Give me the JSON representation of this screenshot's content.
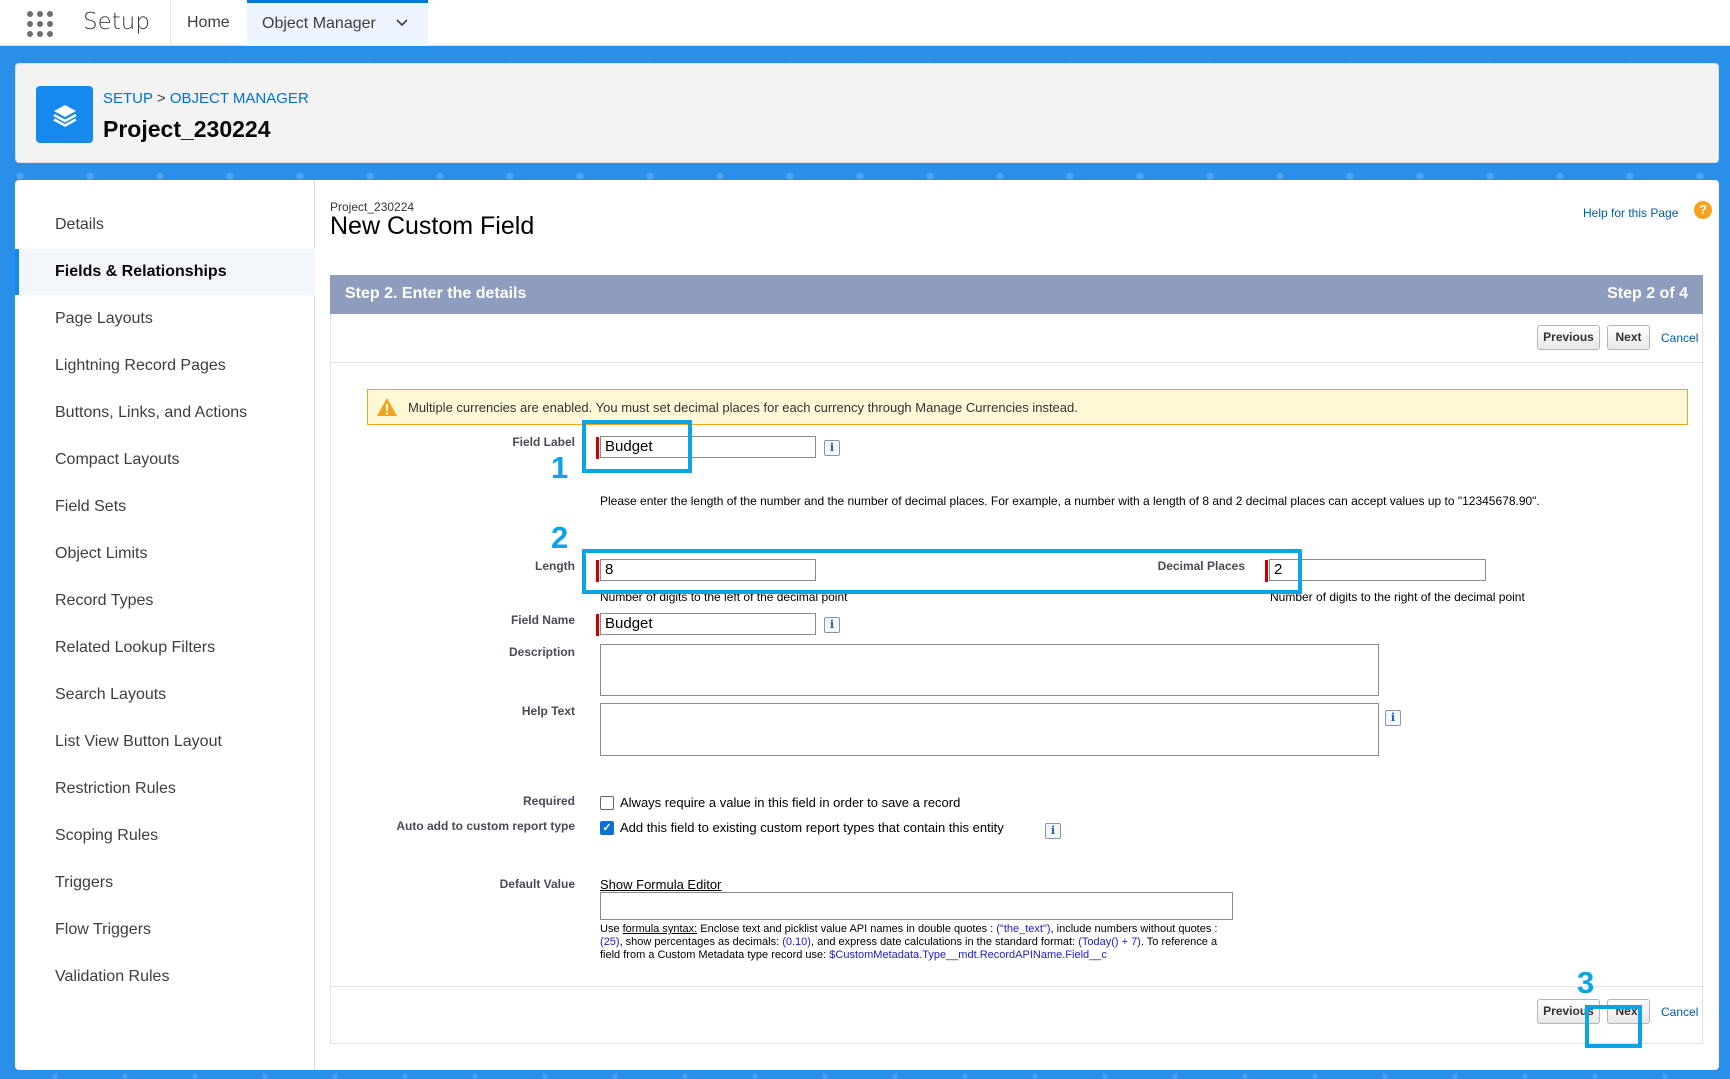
{
  "topnav": {
    "app_name": "Setup",
    "tabs": [
      {
        "label": "Home"
      },
      {
        "label": "Object Manager"
      }
    ]
  },
  "header": {
    "breadcrumb": [
      "SETUP",
      "OBJECT MANAGER"
    ],
    "breadcrumb_sep": ">",
    "title": "Project_230224"
  },
  "sidebar": {
    "items": [
      {
        "label": "Details"
      },
      {
        "label": "Fields & Relationships",
        "active": true
      },
      {
        "label": "Page Layouts"
      },
      {
        "label": "Lightning Record Pages"
      },
      {
        "label": "Buttons, Links, and Actions"
      },
      {
        "label": "Compact Layouts"
      },
      {
        "label": "Field Sets"
      },
      {
        "label": "Object Limits"
      },
      {
        "label": "Record Types"
      },
      {
        "label": "Related Lookup Filters"
      },
      {
        "label": "Search Layouts"
      },
      {
        "label": "List View Button Layout"
      },
      {
        "label": "Restriction Rules"
      },
      {
        "label": "Scoping Rules"
      },
      {
        "label": "Triggers"
      },
      {
        "label": "Flow Triggers"
      },
      {
        "label": "Validation Rules"
      }
    ]
  },
  "page": {
    "object_name": "Project_230224",
    "title": "New Custom Field",
    "help_link": "Help for this Page",
    "help_icon": "?",
    "step_title": "Step 2. Enter the details",
    "step_counter": "Step 2 of 4",
    "buttons": {
      "previous": "Previous",
      "next": "Next",
      "cancel": "Cancel"
    },
    "warning": "Multiple currencies are enabled. You must set decimal places for each currency through Manage Currencies instead.",
    "field_label": {
      "label": "Field Label",
      "value": "Budget"
    },
    "length_help": "Please enter the length of the number and the number of decimal places. For example, a number with a length of 8 and 2 decimal places can accept values up to \"12345678.90\".",
    "length": {
      "label": "Length",
      "value": "8",
      "hint": "Number of digits to the left of the decimal point"
    },
    "decimal_places": {
      "label": "Decimal Places",
      "value": "2",
      "hint": "Number of digits to the right of the decimal point"
    },
    "field_name": {
      "label": "Field Name",
      "value": "Budget"
    },
    "description": {
      "label": "Description",
      "value": ""
    },
    "help_text": {
      "label": "Help Text",
      "value": ""
    },
    "required": {
      "label": "Required",
      "text": "Always require a value in this field in order to save a record",
      "checked": false
    },
    "auto_add": {
      "label": "Auto add to custom report type",
      "text": "Add this field to existing custom report types that contain this entity",
      "checked": true
    },
    "default_value": {
      "label": "Default Value",
      "formula_link": "Show Formula Editor",
      "help_1": "Use",
      "help_link": "formula syntax:",
      "help_2": "Enclose text and picklist value API names in double quotes :",
      "code_1": "(\"the_text\")",
      "help_3": ", include numbers",
      "help_4": "without quotes :",
      "code_2": "(25)",
      "help_5": ", show percentages as decimals:",
      "code_3": "(0.10)",
      "help_6": ", and express date calculations in the standard format:",
      "code_4": "(Today() + 7)",
      "help_7": ". To reference a field from a Custom Metadata type record use:",
      "code_5": "$CustomMetadata.Type__mdt.RecordAPIName.Field__c"
    },
    "info_glyph": "i",
    "check_glyph": "✓"
  },
  "annotations": [
    "1",
    "2",
    "3"
  ],
  "colors": {
    "highlight": "#0aa5e6",
    "brand_blue": "#2a8fe8",
    "step_bar": "#8e9dbe",
    "required_bar": "#cc0000",
    "warning_bg": "#fff8d7"
  }
}
